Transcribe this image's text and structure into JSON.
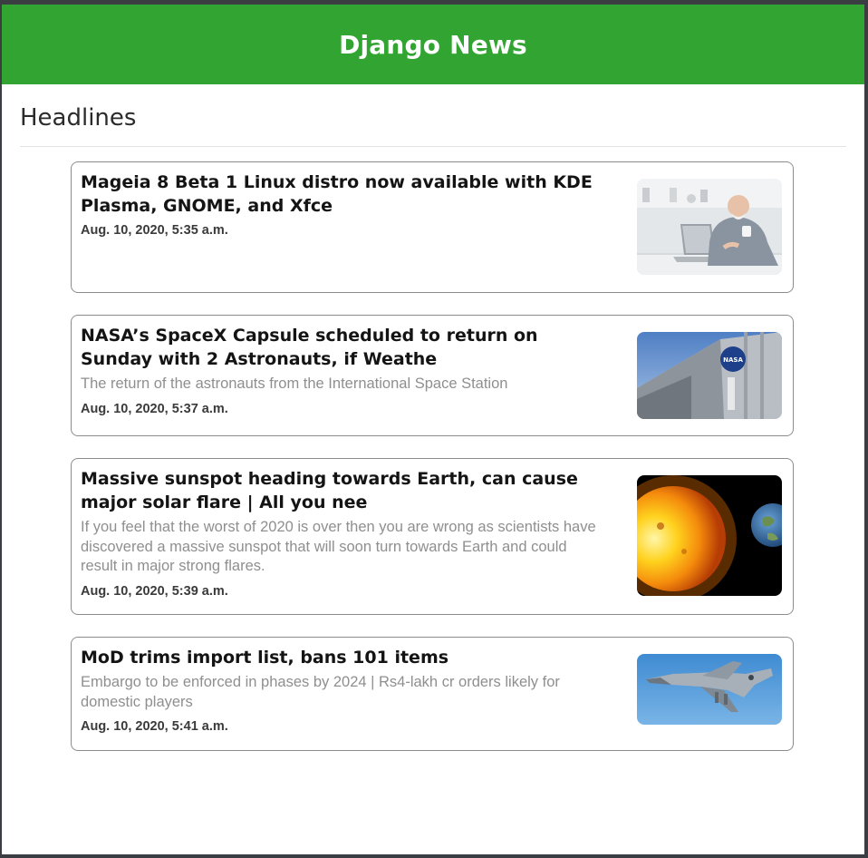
{
  "navbar": {
    "brand": "Django News"
  },
  "headlines": {
    "title": "Headlines"
  },
  "articles": [
    {
      "title": "Mageia 8 Beta 1 Linux distro now available with KDE Plasma, GNOME, and Xfce",
      "description": "",
      "date": "Aug. 10, 2020, 5:35 a.m.",
      "image": "man-with-laptop"
    },
    {
      "title": "NASA’s SpaceX Capsule scheduled to return on Sunday with 2 Astronauts, if Weathe",
      "description": "The return of the astronauts from the International Space Station",
      "date": "Aug. 10, 2020, 5:37 a.m.",
      "image": "nasa-building"
    },
    {
      "title": "Massive sunspot heading towards Earth, can cause major solar flare | All you nee",
      "description": "If you feel that the worst of 2020 is over then you are wrong as scientists have discovered a massive sunspot that will soon turn towards Earth and could result in major strong flares.",
      "date": "Aug. 10, 2020, 5:39 a.m.",
      "image": "sun-and-earth"
    },
    {
      "title": "MoD trims import list, bans 101 items",
      "description": "Embargo to be enforced in phases by 2024 | Rs4-lakh cr orders likely for domestic players",
      "date": "Aug. 10, 2020, 5:41 a.m.",
      "image": "fighter-jet"
    }
  ],
  "colors": {
    "navbar": "#31a431",
    "brand_text": "#ffffff",
    "card_border": "#8c8c8c",
    "description_text": "#8f8f8f"
  }
}
